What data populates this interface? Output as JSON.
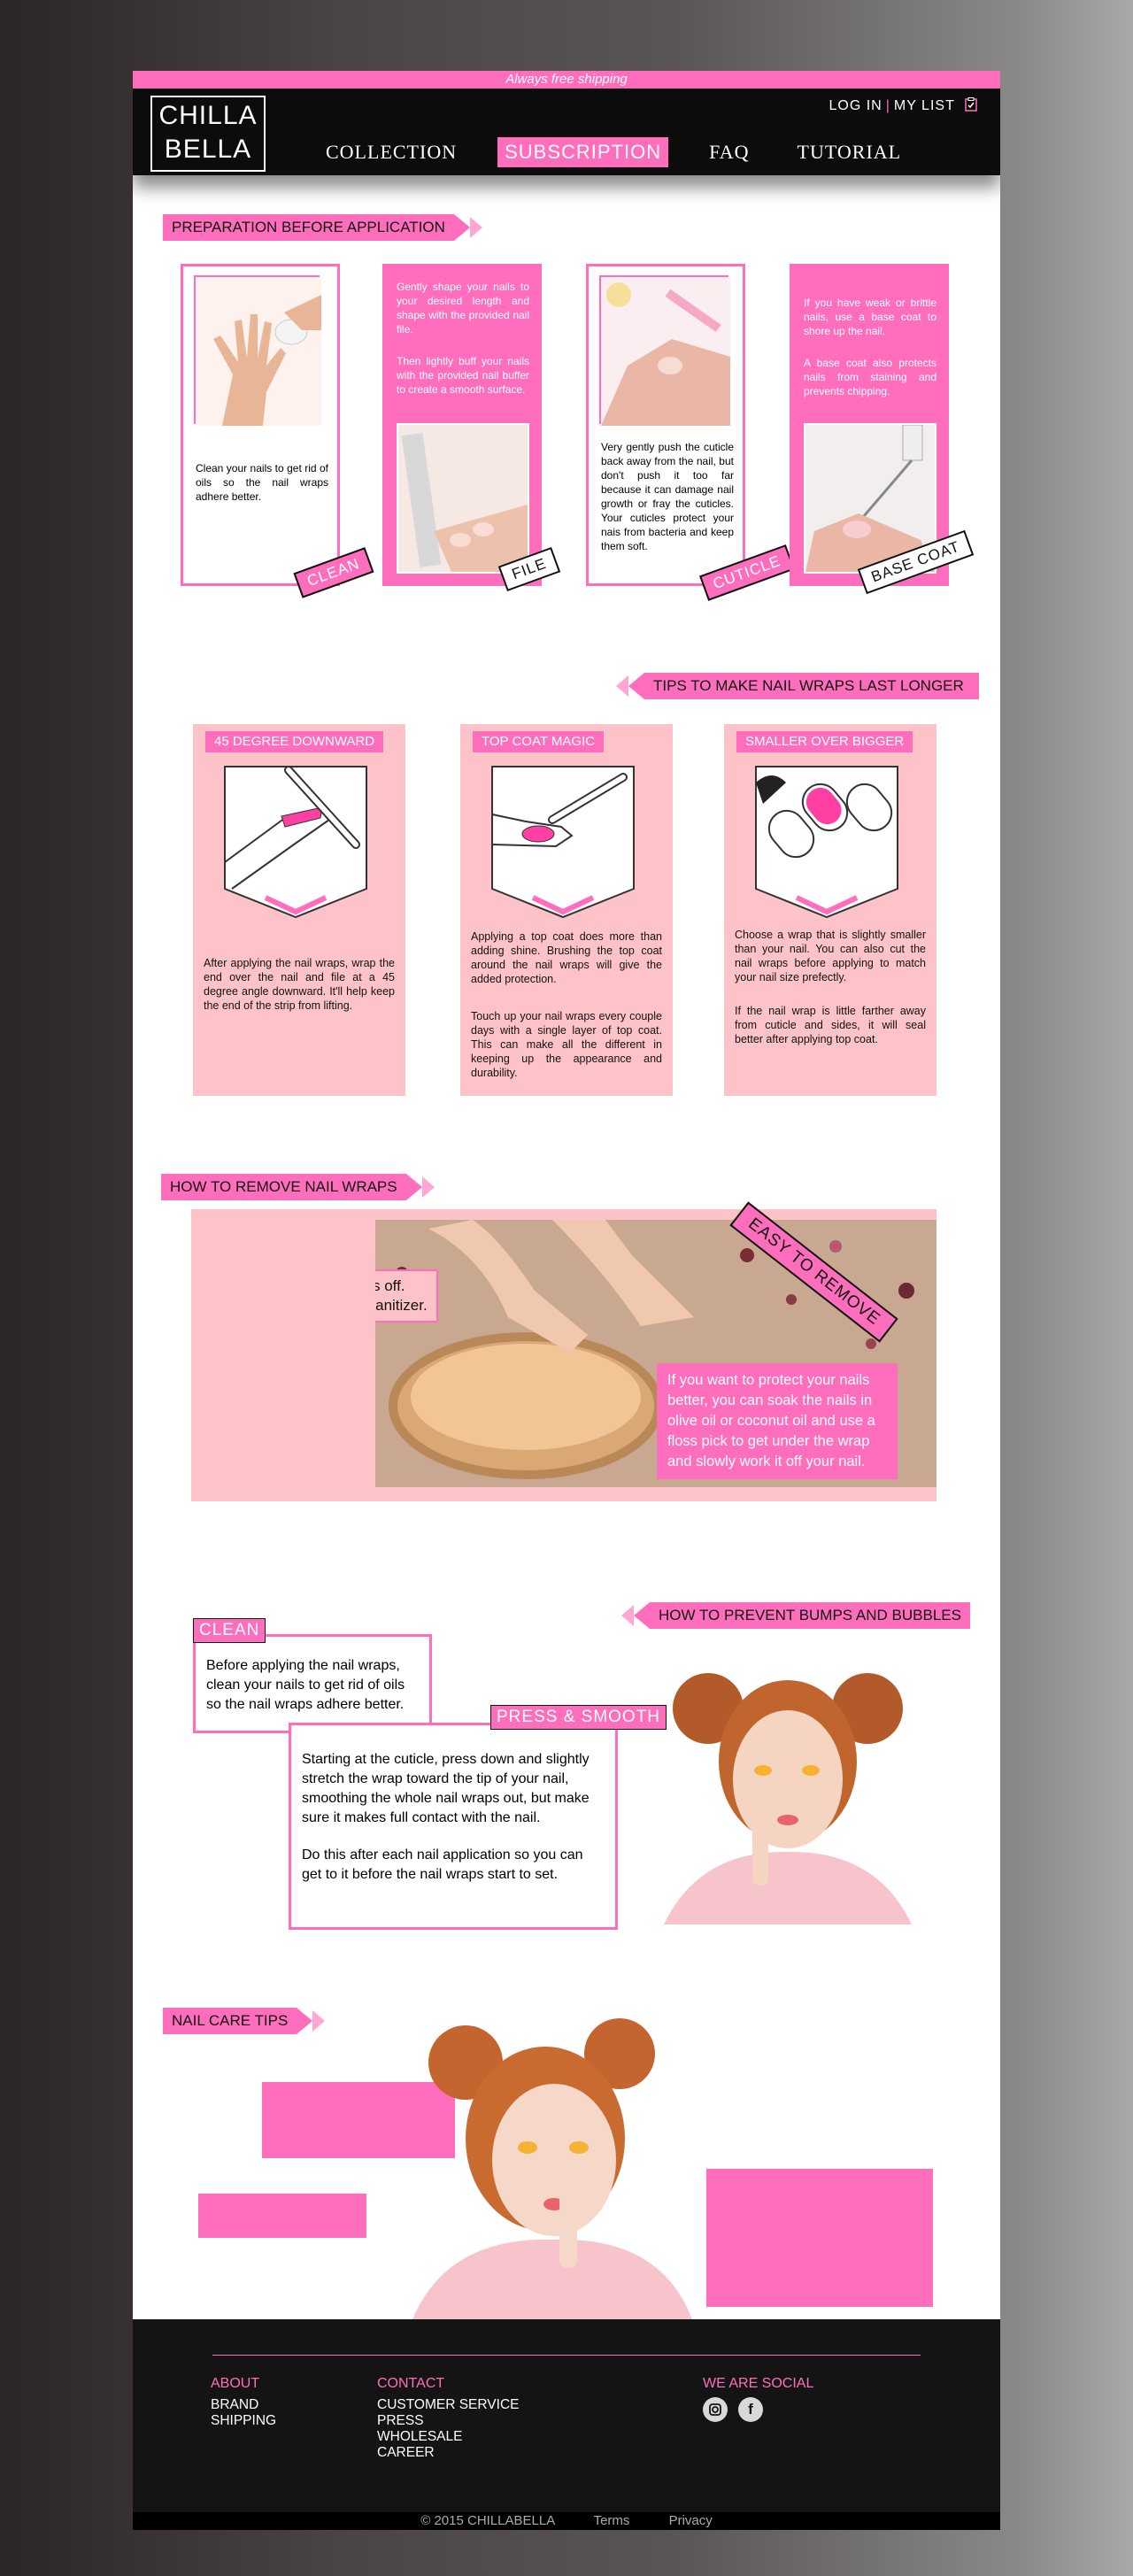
{
  "header": {
    "shipping": "Always free shipping",
    "logo_line1": "CHILLA",
    "logo_line2": "BELLA",
    "login": "LOG IN",
    "my_list": "MY LIST",
    "nav": [
      "COLLECTION",
      "SUBSCRIPTION",
      "FAQ",
      "TUTORIAL"
    ],
    "active_nav": "SUBSCRIPTION"
  },
  "prep": {
    "title": "PREPARATION BEFORE APPLICATION",
    "clean_text": "Clean your nails to get rid of oils so the nail wraps adhere better.",
    "clean_tag": "CLEAN",
    "file_text1": "Gently shape your nails to your desired length and shape with the provided nail file.",
    "file_text2": "Then lightly buff your nails with the provided nail buffer to create a smooth surface.",
    "file_tag": "FILE",
    "cuticle_text": "Very gently push the cuticle back away from the nail, but don't push it too far because it can damage nail growth or fray the cuticles. Your cuticles protect your nais from bacteria and keep them soft.",
    "cuticle_tag": "CUTICLE",
    "base_text1": "If you have weak or brittle nails, use a base coat to shore up the nail.",
    "base_text2": "A base coat also protects nails from staining and prevents chipping.",
    "base_tag": "BASE COAT"
  },
  "tips": {
    "title": "TIPS TO MAKE NAIL WRAPS LAST LONGER",
    "items": [
      {
        "label": "45 DEGREE DOWNWARD",
        "text1": "After applying the nail wraps, wrap the end over the nail and file at a 45 degree angle downward. It'll help keep the end of the strip from lifting.",
        "text2": ""
      },
      {
        "label": "TOP COAT MAGIC",
        "text1": "Applying a top coat does more than adding shine. Brushing the top coat around the nail wraps will give the added protection.",
        "text2": "Touch up your nail wraps every couple days with a single layer of top coat. This can make all the different in keeping up the appearance and durability."
      },
      {
        "label": "SMALLER OVER BIGGER",
        "text1": "Choose a wrap that is slightly smaller than your nail. You can also cut the nail wraps before applying to match your nail size prefectly.",
        "text2": "If the nail wrap is little farther away from cuticle and sides, it will seal better after applying top coat."
      }
    ]
  },
  "remove": {
    "title": "HOW TO REMOVE NAIL WRAPS",
    "peel_line1": "Simply peel the nail wraps off.",
    "peel_line2": "Wash nails with soap or sanitizer.",
    "soak": "If you want to protect your nails better, you can soak the nails in olive oil or coconut oil and use a floss pick to get under the wrap and slowly work it off your nail.",
    "easy": "EASY TO REMOVE"
  },
  "bumps": {
    "title": "HOW TO PREVENT BUMPS AND BUBBLES",
    "clean_label": "CLEAN",
    "clean_text": "Before applying the nail wraps, clean your nails to get rid of oils so the nail wraps adhere better.",
    "press_label": "PRESS & SMOOTH",
    "press_text1": "Starting at the cuticle, press down and slightly stretch the wrap toward the tip of your nail, smoothing the whole nail wraps out, but make sure it makes full contact with the nail.",
    "press_text2": "Do this after each nail application so you can get to it before the nail wraps start to set."
  },
  "care": {
    "title": "NAIL CARE TIPS"
  },
  "footer": {
    "about": "ABOUT",
    "about_links": [
      "BRAND",
      "SHIPPING"
    ],
    "contact": "CONTACT",
    "contact_links": [
      "CUSTOMER SERVICE",
      "PRESS",
      "WHOLESALE",
      "CAREER"
    ],
    "social": "WE ARE SOCIAL",
    "copyright": "© 2015 CHILLABELLA",
    "terms": "Terms",
    "privacy": "Privacy"
  },
  "colors": {
    "brand_pink": "#ff6ebd",
    "light_pink": "#fec3c8",
    "header_black": "#0c0c0c"
  }
}
